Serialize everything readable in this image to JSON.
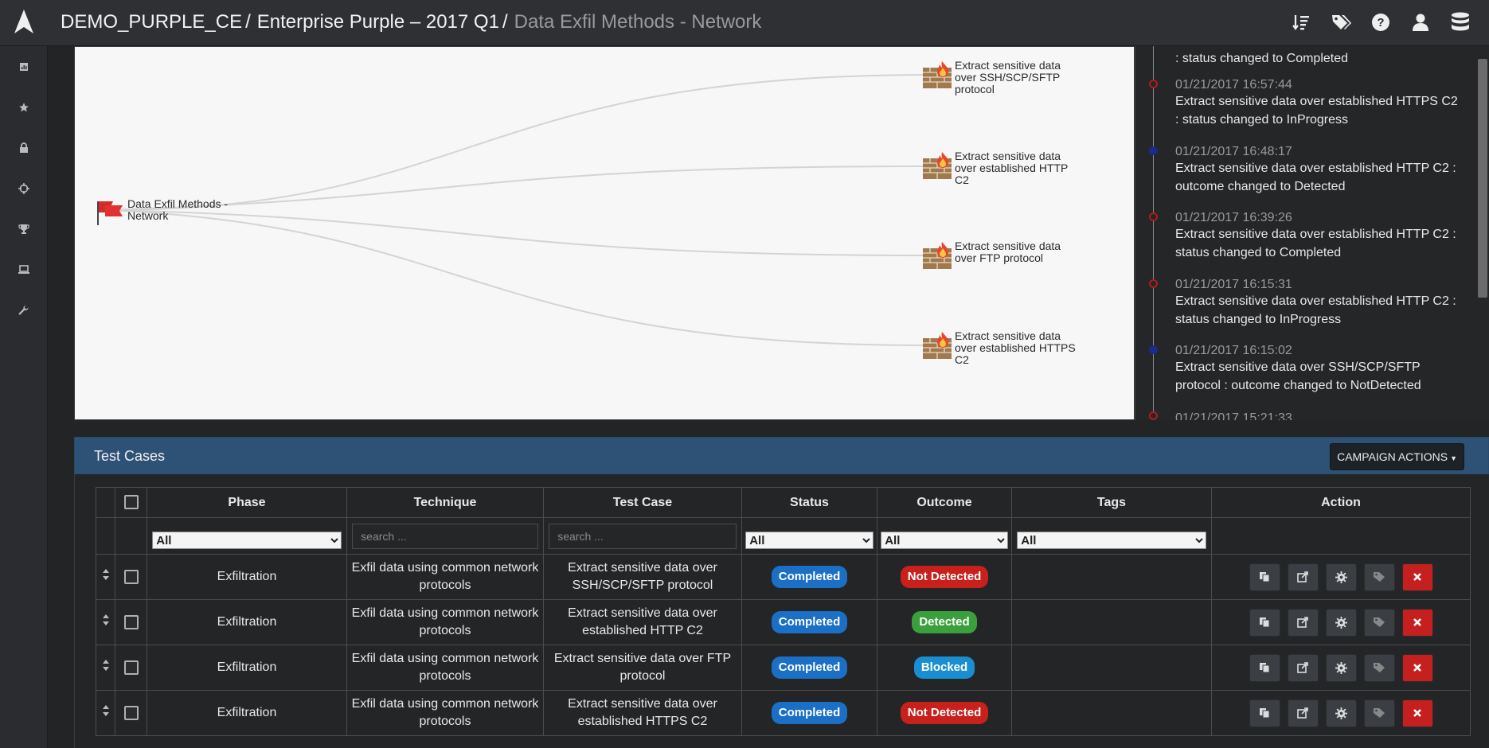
{
  "breadcrumb": {
    "org": "DEMO_PURPLE_CE",
    "campaign": "Enterprise Purple – 2017 Q1",
    "current": "Data Exfil Methods - Network",
    "separator": "/"
  },
  "top_icons": [
    "sort-icon",
    "tags-icon",
    "help-icon",
    "user-icon",
    "database-icon"
  ],
  "sidebar": [
    "dashboard-icon",
    "star-icon",
    "lock-icon",
    "crosshair-icon",
    "trophy-icon",
    "laptop-icon",
    "wrench-icon"
  ],
  "graph": {
    "root": "Data Exfil Methods - Network",
    "root_lines": [
      "Data Exfil Methods -",
      "Network"
    ],
    "nodes": [
      {
        "lines": [
          "Extract sensitive data",
          "over SSH/SCP/SFTP",
          "protocol"
        ]
      },
      {
        "lines": [
          "Extract sensitive data",
          "over established HTTP",
          "C2"
        ]
      },
      {
        "lines": [
          "Extract sensitive data",
          "over FTP protocol"
        ]
      },
      {
        "lines": [
          "Extract sensitive data",
          "over established HTTPS",
          "C2"
        ]
      }
    ]
  },
  "timeline": [
    {
      "time": "",
      "text": ": status changed to Completed",
      "dot": "none"
    },
    {
      "time": "01/21/2017 16:57:44",
      "text": "Extract sensitive data over established HTTPS C2 : status changed to InProgress",
      "dot": "red"
    },
    {
      "time": "01/21/2017 16:48:17",
      "text": "Extract sensitive data over established HTTP C2 : outcome changed to Detected",
      "dot": "blue"
    },
    {
      "time": "01/21/2017 16:39:26",
      "text": "Extract sensitive data over established HTTP C2 : status changed to Completed",
      "dot": "red"
    },
    {
      "time": "01/21/2017 16:15:31",
      "text": "Extract sensitive data over established HTTP C2 : status changed to InProgress",
      "dot": "red"
    },
    {
      "time": "01/21/2017 16:15:02",
      "text": "Extract sensitive data over SSH/SCP/SFTP protocol : outcome changed to NotDetected",
      "dot": "blue"
    },
    {
      "time": "01/21/2017 15:21:33",
      "text": "",
      "dot": "red"
    }
  ],
  "test_cases": {
    "title": "Test Cases",
    "campaign_actions": "CAMPAIGN ACTIONS",
    "columns": [
      "Phase",
      "Technique",
      "Test Case",
      "Status",
      "Outcome",
      "Tags",
      "Action"
    ],
    "filters": {
      "phase": "All",
      "technique_placeholder": "search ...",
      "testcase_placeholder": "search ...",
      "status": "All",
      "outcome": "All",
      "tags": "All"
    },
    "rows": [
      {
        "phase": "Exfiltration",
        "technique": "Exfil data using common network protocols",
        "test_case": "Extract sensitive data over SSH/SCP/SFTP protocol",
        "status": "Completed",
        "outcome": "Not Detected",
        "tags": ""
      },
      {
        "phase": "Exfiltration",
        "technique": "Exfil data using common network protocols",
        "test_case": "Extract sensitive data over established HTTP C2",
        "status": "Completed",
        "outcome": "Detected",
        "tags": ""
      },
      {
        "phase": "Exfiltration",
        "technique": "Exfil data using common network protocols",
        "test_case": "Extract sensitive data over FTP protocol",
        "status": "Completed",
        "outcome": "Blocked",
        "tags": ""
      },
      {
        "phase": "Exfiltration",
        "technique": "Exfil data using common network protocols",
        "test_case": "Extract sensitive data over established HTTPS C2",
        "status": "Completed",
        "outcome": "Not Detected",
        "tags": ""
      }
    ],
    "row_actions": [
      "copy-icon",
      "share-icon",
      "gear-icon",
      "tag-icon",
      "delete-icon"
    ]
  },
  "colors": {
    "completed": "#1b6fc4",
    "not_detected": "#c7201d",
    "detected": "#3aa03c",
    "blocked": "#1a8fd0",
    "header_blue": "#2e5275"
  }
}
